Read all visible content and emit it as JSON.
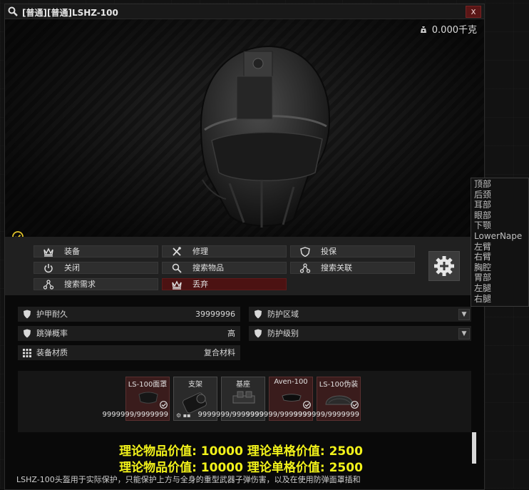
{
  "window": {
    "title": "[普通][普通]LSHZ-100",
    "close_label": "x",
    "weight": "0.000千克"
  },
  "actions": {
    "row1": [
      "装备",
      "修理",
      "投保"
    ],
    "row2": [
      "关闭",
      "搜索物品",
      "搜索关联"
    ],
    "row3": [
      "搜索需求",
      "丢弃"
    ]
  },
  "properties": {
    "durability_label": "护甲耐久",
    "durability_value": "39999996",
    "ricochet_label": "跳弹概率",
    "ricochet_value": "高",
    "material_label": "装备材质",
    "material_value": "复合材料",
    "protect_area_label": "防护区域",
    "protect_class_label": "防护级别"
  },
  "slots": [
    {
      "name": "LS-100面罩",
      "value": "9999999/9999999"
    },
    {
      "name": "支架",
      "value": ""
    },
    {
      "name": "基座",
      "value": "9999999/9999999"
    },
    {
      "name": "Aven-100",
      "value": "9999999/9999999"
    },
    {
      "name": "LS-100伪装",
      "value": "9999999/9999999"
    }
  ],
  "prices": {
    "line1": "理论物品价值: 10000 理论单格价值: 2500",
    "line2": "理论物品价值: 10000 理论单格价值: 2500"
  },
  "description": "LSHZ-100头盔用于实际保护，只能保护上方与全身的重型武器子弹伤害，以及在使用防弹面罩插和",
  "body_zones": [
    "顶部",
    "后颈",
    "耳部",
    "眼部",
    "下颚",
    "LowerNape",
    "左臂",
    "右臂",
    "胸腔",
    "胃部",
    "左腿",
    "右腿"
  ],
  "colors": {
    "price_text": "#f2f21a",
    "danger_button": "#4c1212",
    "accent_check": "#e0c22a"
  },
  "icons": {
    "title": "magnifier-icon",
    "weight": "weight-bag-icon",
    "gear": "gear-plus-icon"
  }
}
